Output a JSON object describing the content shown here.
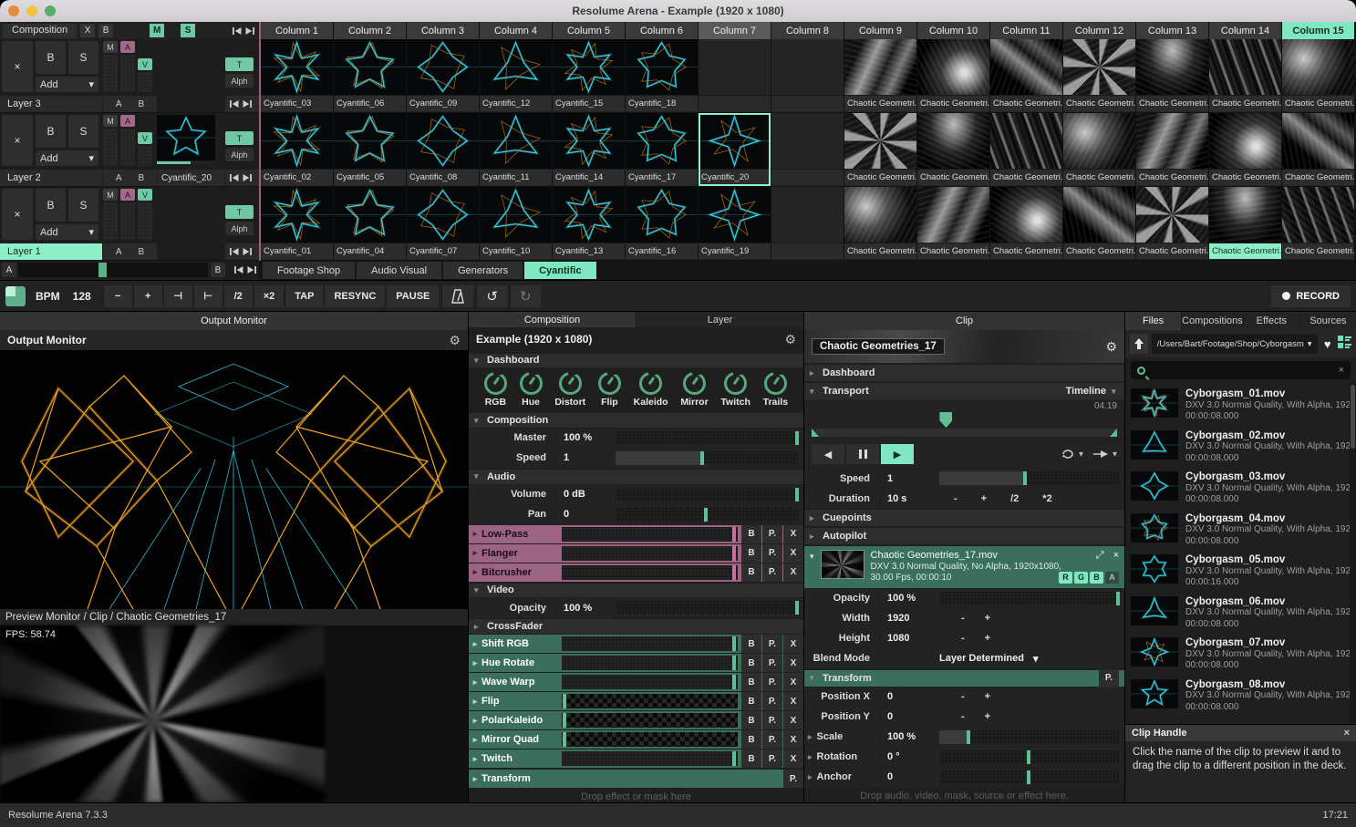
{
  "window": {
    "title": "Resolume Arena - Example (1920 x 1080)"
  },
  "icons": {
    "gear": "⚙",
    "heart": "♥",
    "undo": "↺",
    "redo": "↻",
    "dropdown": "▾",
    "collapsed": "▸",
    "expanded": "▾",
    "close": "×",
    "back": "◀",
    "play": "▶",
    "expand": "⤢"
  },
  "deck": {
    "composition_label": "Composition",
    "header_buttons": {
      "x": "X",
      "b": "B",
      "m": "M",
      "s": "S"
    },
    "columns": [
      "Column 1",
      "Column 2",
      "Column 3",
      "Column 4",
      "Column 5",
      "Column 6",
      "Column 7",
      "Column 8",
      "Column 9",
      "Column 10",
      "Column 11",
      "Column 12",
      "Column 13",
      "Column 14",
      "Column 15"
    ],
    "active_column_index": 14,
    "highlight_column_index": 6,
    "layer_buttons": {
      "bypass": "B",
      "solo": "S",
      "blend": "Add",
      "m": "M",
      "a": "A",
      "v": "V",
      "t": "T",
      "alpha": "Alph",
      "fade_a": "A",
      "fade_b": "B"
    },
    "layers": [
      {
        "name": "Layer 3"
      },
      {
        "name": "Layer 2",
        "clip_label": "Cyantific_20"
      },
      {
        "name": "Layer 1"
      }
    ],
    "grid": [
      [
        "Cyantific_03",
        "Cyantific_06",
        "Cyantific_09",
        "Cyantific_12",
        "Cyantific_15",
        "Cyantific_18",
        "",
        "",
        "Chaotic Geometri...",
        "Chaotic Geometri...",
        "Chaotic Geometri...",
        "Chaotic Geometri...",
        "Chaotic Geometri...",
        "Chaotic Geometri...",
        "Chaotic Geometri..."
      ],
      [
        "Cyantific_02",
        "Cyantific_05",
        "Cyantific_08",
        "Cyantific_11",
        "Cyantific_14",
        "Cyantific_17",
        "Cyantific_20",
        "",
        "Chaotic Geometri...",
        "Chaotic Geometri...",
        "Chaotic Geometri...",
        "Chaotic Geometri...",
        "Chaotic Geometri...",
        "Chaotic Geometri...",
        "Chaotic Geometri..."
      ],
      [
        "Cyantific_01",
        "Cyantific_04",
        "Cyantific_07",
        "Cyantific_10",
        "Cyantific_13",
        "Cyantific_16",
        "Cyantific_19",
        "",
        "Chaotic Geometri...",
        "Chaotic Geometri...",
        "Chaotic Geometri...",
        "Chaotic Geometri...",
        "Chaotic Geometri...",
        "Chaotic Geometri...",
        "Chaotic Geometri..."
      ]
    ],
    "selected_cell": [
      1,
      6
    ],
    "playing_cell": [
      2,
      13
    ],
    "crossfader": {
      "a": "A",
      "b": "B",
      "position": 0.44
    },
    "tabs": [
      "Footage Shop",
      "Audio Visual",
      "Generators",
      "Cyantific"
    ],
    "active_tab_index": 3
  },
  "transport_bar": {
    "bpm_label": "BPM",
    "bpm_value": "128",
    "buttons": [
      "−",
      "+",
      "⊣",
      "⊢",
      "/2",
      "×2",
      "TAP",
      "RESYNC",
      "PAUSE"
    ],
    "record_label": "RECORD"
  },
  "output_monitor": {
    "tab": "Output Monitor",
    "title": "Output Monitor",
    "preview_label": "Preview Monitor / Clip / Chaotic Geometries_17",
    "fps": "FPS: 58.74"
  },
  "composition": {
    "tabs": [
      "Composition",
      "Layer"
    ],
    "title": "Example (1920 x 1080)",
    "dashboard_label": "Dashboard",
    "knobs": [
      "RGB",
      "Hue",
      "Distort",
      "Flip",
      "Kaleido",
      "Mirror",
      "Twitch",
      "Trails"
    ],
    "composition_label": "Composition",
    "composition_params": [
      {
        "label": "Master",
        "value": "100 %",
        "control": "slider",
        "pos": 1
      },
      {
        "label": "Speed",
        "value": "1",
        "control": "slider",
        "pos": 0.48,
        "fill": true
      }
    ],
    "audio_label": "Audio",
    "audio_params": [
      {
        "label": "Volume",
        "value": "0 dB",
        "control": "slider",
        "pos": 1
      },
      {
        "label": "Pan",
        "value": "0",
        "control": "slider",
        "pos": 0.5
      }
    ],
    "audio_effects": [
      {
        "name": "Low-Pass",
        "slider": "solid"
      },
      {
        "name": "Flanger",
        "slider": "solid"
      },
      {
        "name": "Bitcrusher",
        "slider": "solid"
      }
    ],
    "video_label": "Video",
    "video_params": [
      {
        "label": "Opacity",
        "value": "100 %",
        "control": "slider",
        "pos": 1
      }
    ],
    "crossfader_label": "CrossFader",
    "video_effects": [
      {
        "name": "Shift RGB",
        "slider": "solid"
      },
      {
        "name": "Hue Rotate",
        "slider": "solid"
      },
      {
        "name": "Wave Warp",
        "slider": "solid"
      },
      {
        "name": "Flip",
        "slider": "checker"
      },
      {
        "name": "PolarKaleido",
        "slider": "checker"
      },
      {
        "name": "Mirror Quad",
        "slider": "checker"
      },
      {
        "name": "Twitch",
        "slider": "solid"
      }
    ],
    "transform_label": "Transform",
    "effect_buttons": [
      "B",
      "P.",
      "X"
    ],
    "drop_hint": "Drop effect or mask here"
  },
  "clip": {
    "tab": "Clip",
    "name": "Chaotic Geometries_17",
    "dashboard_label": "Dashboard",
    "transport_label": "Transport",
    "transport_mode": "Timeline",
    "time_display": "04.19",
    "playhead": 0.44,
    "speed_row": {
      "label": "Speed",
      "value": "1",
      "control": "slider",
      "pos": 0.48,
      "fill": true
    },
    "duration_row": {
      "label": "Duration",
      "value": "10 s",
      "buttons": [
        "-",
        "+",
        "/2",
        "*2"
      ]
    },
    "cuepoints_label": "Cuepoints",
    "autopilot_label": "Autopilot",
    "file_info": {
      "name": "Chaotic Geometries_17.mov",
      "specs": "DXV 3.0 Normal Quality, No Alpha, 1920x1080,",
      "specs2": "30.00 Fps, 00:00:10",
      "channels": [
        "R",
        "G",
        "B",
        "A"
      ]
    },
    "clip_params": [
      {
        "label": "Opacity",
        "value": "100 %",
        "control": "slider",
        "pos": 1
      },
      {
        "label": "Width",
        "value": "1920",
        "control": "stepper"
      },
      {
        "label": "Height",
        "value": "1080",
        "control": "stepper"
      },
      {
        "label": "Blend Mode",
        "value": "Layer Determined",
        "control": "dropdown"
      }
    ],
    "transform_label": "Transform",
    "transform_params": [
      {
        "label": "Position X",
        "value": "0",
        "control": "stepper"
      },
      {
        "label": "Position Y",
        "value": "0",
        "control": "stepper"
      },
      {
        "label": "Scale",
        "value": "100 %",
        "control": "slider",
        "pos": 0.17,
        "fill": true,
        "arrow": true
      },
      {
        "label": "Rotation",
        "value": "0 °",
        "control": "slider",
        "pos": 0.5,
        "arrow": true
      },
      {
        "label": "Anchor",
        "value": "0",
        "control": "slider",
        "pos": 0.5,
        "arrow": true
      }
    ],
    "stepper": {
      "minus": "-",
      "plus": "+"
    },
    "drop_hint": "Drop audio, video, mask, source or effect here."
  },
  "browser": {
    "tabs": [
      "Files",
      "Compositions",
      "Effects",
      "Sources"
    ],
    "active_tab_index": 0,
    "path": "/Users/Bart/Footage/Shop/Cyborgasm",
    "files": [
      {
        "name": "Cyborgasm_01.mov",
        "detail": "DXV 3.0 Normal Quality, With Alpha, 192",
        "duration": "00:00:08.000"
      },
      {
        "name": "Cyborgasm_02.mov",
        "detail": "DXV 3.0 Normal Quality, With Alpha, 192",
        "duration": "00:00:08.000"
      },
      {
        "name": "Cyborgasm_03.mov",
        "detail": "DXV 3.0 Normal Quality, With Alpha, 192",
        "duration": "00:00:08.000"
      },
      {
        "name": "Cyborgasm_04.mov",
        "detail": "DXV 3.0 Normal Quality, With Alpha, 192",
        "duration": "00:00:08.000"
      },
      {
        "name": "Cyborgasm_05.mov",
        "detail": "DXV 3.0 Normal Quality, With Alpha, 192",
        "duration": "00:00:16.000"
      },
      {
        "name": "Cyborgasm_06.mov",
        "detail": "DXV 3.0 Normal Quality, With Alpha, 192",
        "duration": "00:00:08.000"
      },
      {
        "name": "Cyborgasm_07.mov",
        "detail": "DXV 3.0 Normal Quality, With Alpha, 192",
        "duration": "00:00:08.000"
      },
      {
        "name": "Cyborgasm_08.mov",
        "detail": "DXV 3.0 Normal Quality, With Alpha, 192",
        "duration": "00:00:08.000"
      }
    ],
    "clip_handle_title": "Clip Handle",
    "clip_handle_text": "Click the name of the clip to preview it and to drag the clip to a different position in the deck."
  },
  "status": {
    "app_version": "Resolume Arena 7.3.3",
    "clock": "17:21"
  }
}
